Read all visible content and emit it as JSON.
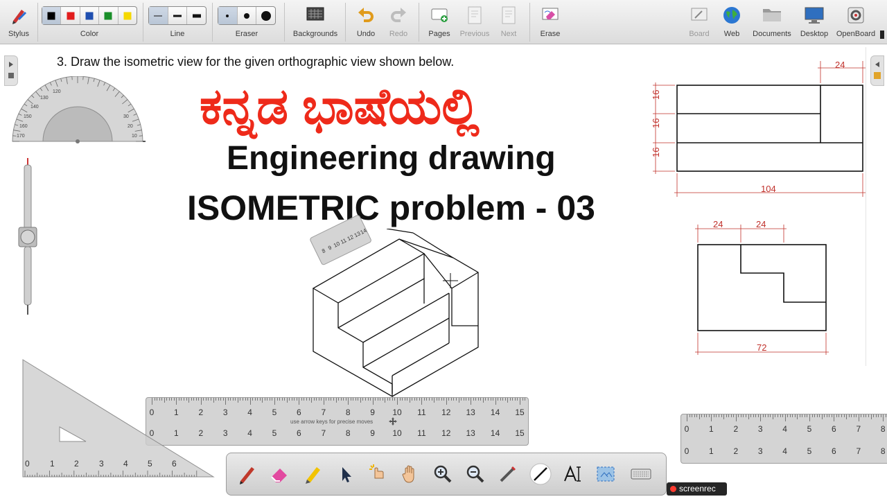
{
  "toolbar": {
    "stylus": "Stylus",
    "color": "Color",
    "line": "Line",
    "eraser": "Eraser",
    "backgrounds": "Backgrounds",
    "undo": "Undo",
    "redo": "Redo",
    "pages": "Pages",
    "previous": "Previous",
    "next": "Next",
    "erase": "Erase",
    "board": "Board",
    "web": "Web",
    "documents": "Documents",
    "desktop": "Desktop",
    "openboard": "OpenBoard",
    "color_swatches": [
      "#000000",
      "#e11d1d",
      "#1f4fb0",
      "#1a8f2a",
      "#f5d800"
    ]
  },
  "page": {
    "instruction": "3. Draw the isometric view for the given orthographic view shown below.",
    "kannada_title": "ಕನ್ನಡ ಭಾಷೆಯಲ್ಲಿ",
    "title_line1": "Engineering drawing",
    "title_line2": "ISOMETRIC problem - 03"
  },
  "front_view": {
    "dim_top": "24",
    "dim_left": [
      "16",
      "16",
      "16"
    ],
    "dim_bottom": "104"
  },
  "top_view": {
    "dim_top": [
      "24",
      "24"
    ],
    "dim_bottom": "72"
  },
  "ruler_main": {
    "numbers": [
      "0",
      "1",
      "2",
      "3",
      "4",
      "5",
      "6",
      "7",
      "8",
      "9",
      "10",
      "11",
      "12",
      "13",
      "14",
      "15"
    ],
    "hint": "use arrow keys for precise moves"
  },
  "ruler_small": {
    "numbers": [
      "8",
      "9",
      "10",
      "11",
      "12",
      "13",
      "14"
    ]
  },
  "ruler_right": {
    "numbers": [
      "0",
      "1",
      "2",
      "3",
      "4",
      "5",
      "6",
      "7",
      "8"
    ]
  },
  "set_square": {
    "numbers": [
      "0",
      "1",
      "2",
      "3",
      "4",
      "5",
      "6"
    ]
  },
  "protractor": {
    "numbers": [
      "120",
      "130",
      "140",
      "150",
      "160",
      "170",
      "30",
      "20",
      "10"
    ]
  },
  "recorder": {
    "label": "screenrec"
  },
  "colors": {
    "accent_red": "#ee2a1a",
    "dim_red": "#c0302a"
  }
}
